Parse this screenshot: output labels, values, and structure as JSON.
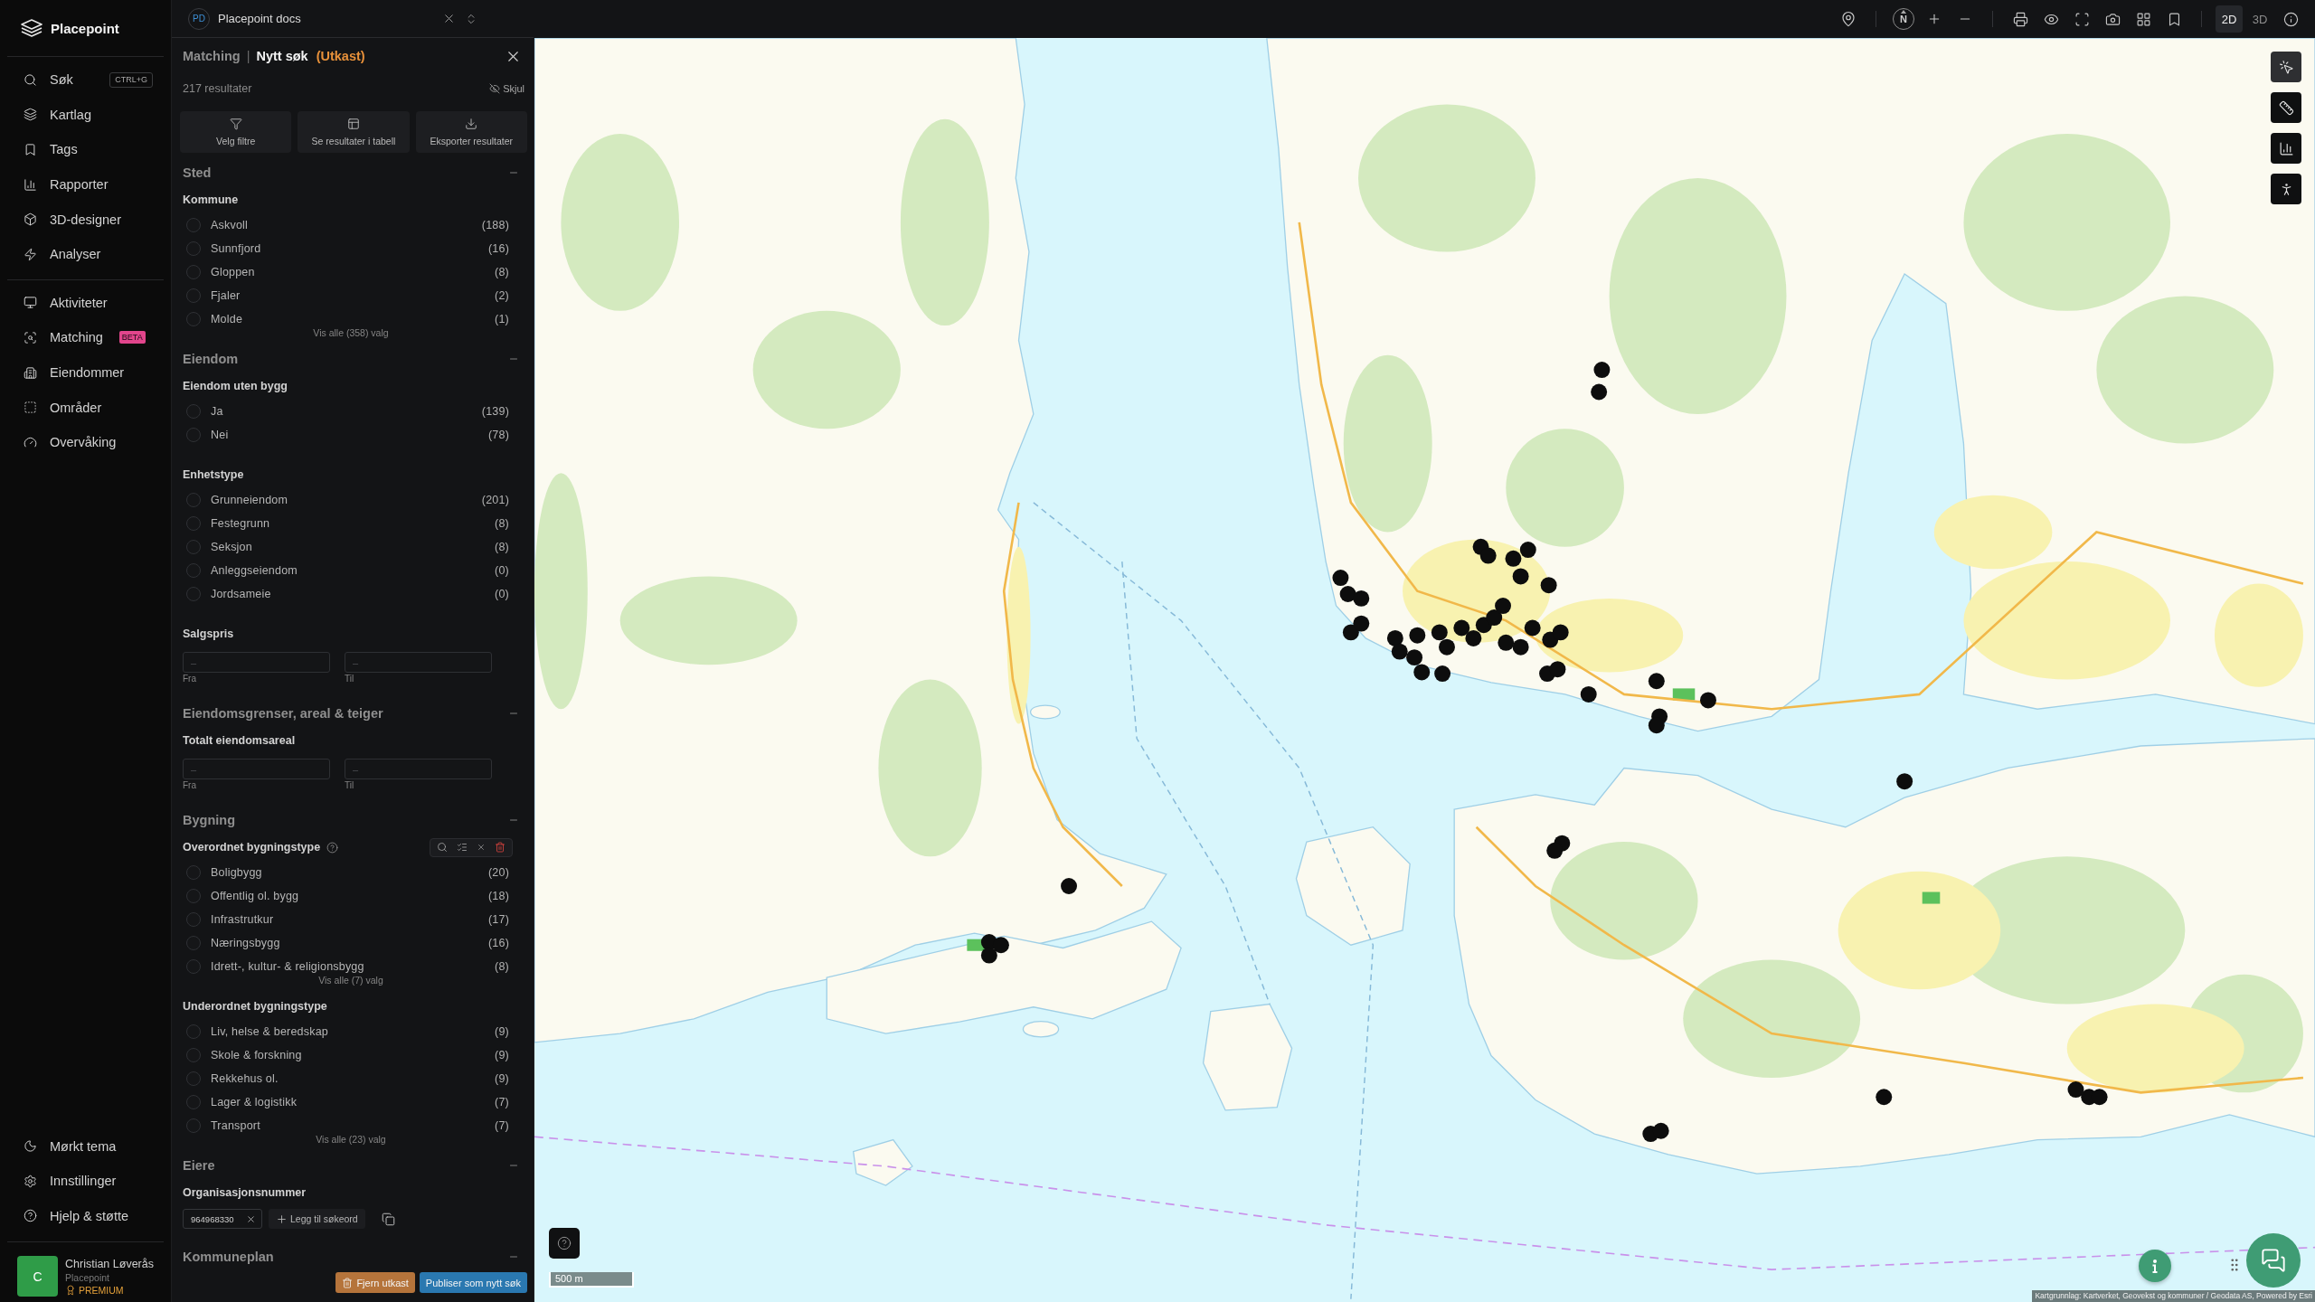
{
  "sidebar": {
    "logo": "Placepoint",
    "main_items": [
      {
        "label": "Søk",
        "shortcut": "CTRL+G"
      },
      {
        "label": "Kartlag"
      },
      {
        "label": "Tags"
      },
      {
        "label": "Rapporter"
      },
      {
        "label": "3D-designer"
      },
      {
        "label": "Analyser"
      }
    ],
    "tool_items": [
      {
        "label": "Aktiviteter"
      },
      {
        "label": "Matching",
        "badge": "BETA"
      },
      {
        "label": "Eiendommer"
      },
      {
        "label": "Områder"
      },
      {
        "label": "Overvåking"
      }
    ],
    "bottom_items": [
      {
        "label": "Mørkt tema"
      },
      {
        "label": "Innstillinger"
      },
      {
        "label": "Hjelp & støtte"
      }
    ],
    "user": {
      "initial": "C",
      "name": "Christian Løverås",
      "organization": "Placepoint",
      "plan": "PREMIUM"
    }
  },
  "document_switcher": {
    "initials": "PD",
    "title": "Placepoint docs"
  },
  "map_toolbar": {
    "compass": "N",
    "view_modes": [
      {
        "label": "2D",
        "selected": true
      },
      {
        "label": "3D",
        "selected": false
      }
    ]
  },
  "panel": {
    "breadcrumb": "Matching",
    "separator": "|",
    "title": "Nytt søk",
    "status": "(Utkast)",
    "result_count": "217 resultater",
    "hide_label": "Skjul",
    "actions": [
      {
        "label": "Velg filtre"
      },
      {
        "label": "Se resultater i tabell"
      },
      {
        "label": "Eksporter resultater"
      }
    ],
    "sections": [
      {
        "title": "Sted",
        "expanded": true,
        "groups": [
          {
            "kind": "options",
            "title": "Kommune",
            "options": [
              {
                "label": "Askvoll",
                "count": "(188)",
                "checked": false
              },
              {
                "label": "Sunnfjord",
                "count": "(16)",
                "checked": false
              },
              {
                "label": "Gloppen",
                "count": "(8)",
                "checked": false
              },
              {
                "label": "Fjaler",
                "count": "(2)",
                "checked": false
              },
              {
                "label": "Molde",
                "count": "(1)",
                "checked": false
              }
            ],
            "show_all": "Vis alle (358) valg"
          }
        ]
      },
      {
        "title": "Eiendom",
        "expanded": true,
        "groups": [
          {
            "kind": "options",
            "title": "Eiendom uten bygg",
            "options": [
              {
                "label": "Ja",
                "count": "(139)",
                "checked": false
              },
              {
                "label": "Nei",
                "count": "(78)",
                "checked": false
              }
            ]
          },
          {
            "kind": "options",
            "title": "Enhetstype",
            "options": [
              {
                "label": "Grunneiendom",
                "count": "(201)",
                "checked": false
              },
              {
                "label": "Festegrunn",
                "count": "(8)",
                "checked": false
              },
              {
                "label": "Seksjon",
                "count": "(8)",
                "checked": false
              },
              {
                "label": "Anleggseiendom",
                "count": "(0)",
                "checked": false
              },
              {
                "label": "Jordsameie",
                "count": "(0)",
                "checked": false
              }
            ]
          },
          {
            "kind": "range",
            "title": "Salgspris",
            "from": {
              "placeholder": "–",
              "label": "Fra"
            },
            "to": {
              "placeholder": "–",
              "label": "Til"
            }
          }
        ]
      },
      {
        "title": "Eiendomsgrenser, areal & teiger",
        "expanded": true,
        "groups": [
          {
            "kind": "range",
            "title": "Totalt eiendomsareal",
            "from": {
              "placeholder": "–",
              "label": "Fra"
            },
            "to": {
              "placeholder": "–",
              "label": "Til"
            }
          }
        ]
      },
      {
        "title": "Bygning",
        "expanded": true,
        "groups": [
          {
            "kind": "tool_options",
            "title": "Overordnet bygningstype",
            "options": [
              {
                "label": "Boligbygg",
                "count": "(20)",
                "checked": false
              },
              {
                "label": "Offentlig ol. bygg",
                "count": "(18)",
                "checked": false
              },
              {
                "label": "Infrastrutkur",
                "count": "(17)",
                "checked": false
              },
              {
                "label": "Næringsbygg",
                "count": "(16)",
                "checked": false
              },
              {
                "label": "Idrett-, kultur- & religionsbygg",
                "count": "(8)",
                "checked": false
              }
            ],
            "show_all": "Vis alle (7) valg"
          },
          {
            "kind": "options",
            "title": "Underordnet bygningstype",
            "options": [
              {
                "label": "Liv, helse & beredskap",
                "count": "(9)",
                "checked": false
              },
              {
                "label": "Skole & forskning",
                "count": "(9)",
                "checked": false
              },
              {
                "label": "Rekkehus ol.",
                "count": "(9)",
                "checked": false
              },
              {
                "label": "Lager & logistikk",
                "count": "(7)",
                "checked": false
              },
              {
                "label": "Transport",
                "count": "(7)",
                "checked": false
              }
            ],
            "show_all": "Vis alle (23) valg"
          }
        ]
      },
      {
        "title": "Eiere",
        "expanded": true,
        "groups": [
          {
            "kind": "keywords",
            "title": "Organisasjonsnummer",
            "keywords": [
              "964968330"
            ],
            "add_label": "Legg til søkeord"
          }
        ]
      },
      {
        "title": "Kommuneplan",
        "expanded": true
      }
    ],
    "footer_buttons": [
      {
        "label": "Fjern utkast",
        "kind": "danger"
      },
      {
        "label": "Publiser som nytt søk",
        "kind": "primary"
      }
    ]
  },
  "map": {
    "side_tools": [
      {
        "selected": true
      },
      {
        "selected": false
      },
      {
        "selected": false
      },
      {
        "selected": false
      }
    ],
    "scale": "500 m",
    "attribution": "Kartgrunnlag: Kartverket, Geovekst og kommuner / Geodata AS, Powered by Esri"
  }
}
